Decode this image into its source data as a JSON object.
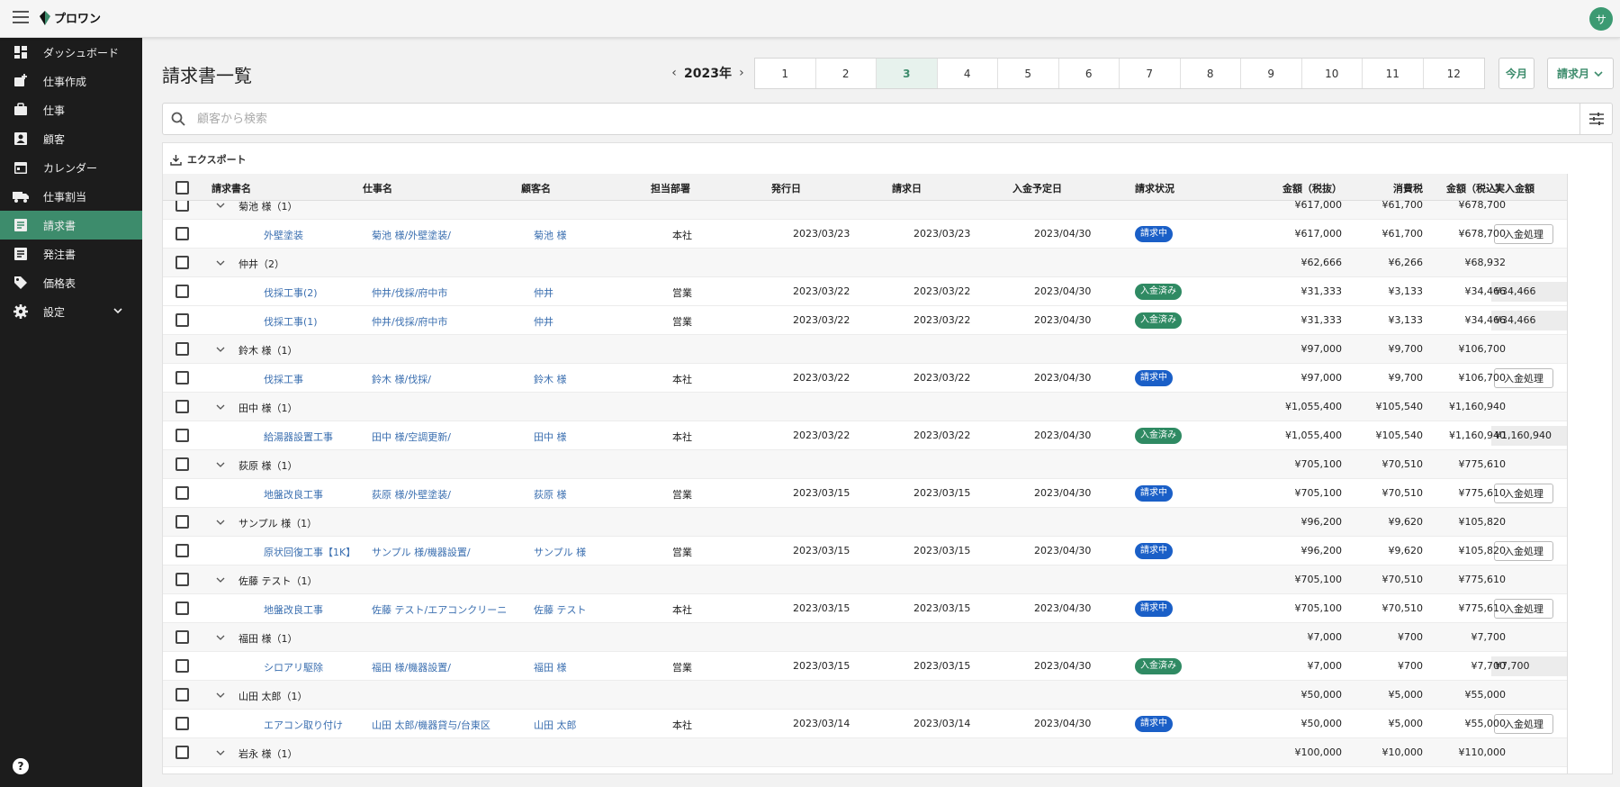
{
  "app": {
    "logo_text": "プロワン",
    "avatar_initial": "サ"
  },
  "sidebar": {
    "items": [
      {
        "label": "ダッシュボード",
        "icon": "dashboard-icon"
      },
      {
        "label": "仕事作成",
        "icon": "add-job-icon"
      },
      {
        "label": "仕事",
        "icon": "briefcase-icon"
      },
      {
        "label": "顧客",
        "icon": "customer-icon"
      },
      {
        "label": "カレンダー",
        "icon": "calendar-icon"
      },
      {
        "label": "仕事割当",
        "icon": "truck-icon"
      },
      {
        "label": "請求書",
        "icon": "invoice-icon",
        "active": true
      },
      {
        "label": "発注書",
        "icon": "order-icon"
      },
      {
        "label": "価格表",
        "icon": "price-tag-icon"
      },
      {
        "label": "設定",
        "icon": "gear-icon"
      }
    ],
    "help": "?"
  },
  "header": {
    "title": "請求書一覧",
    "year": "2023年",
    "months": [
      "1",
      "2",
      "3",
      "4",
      "5",
      "6",
      "7",
      "8",
      "9",
      "10",
      "11",
      "12"
    ],
    "selected_month": "3",
    "this_month_label": "今月",
    "sort_label": "請求月"
  },
  "search": {
    "placeholder": "顧客から検索"
  },
  "toolbar": {
    "export_label": "エクスポート"
  },
  "table": {
    "columns": [
      "請求書名",
      "仕事名",
      "顧客名",
      "担当部署",
      "発行日",
      "請求日",
      "入金予定日",
      "請求状況",
      "金額（税抜）",
      "消費税",
      "金額（税込）",
      "実入金額"
    ],
    "pay_button_label": "入金処理",
    "rows": [
      {
        "type": "group",
        "name": "菊池 様（1）",
        "ex": "¥617,000",
        "tax": "¥61,700",
        "inc": "¥678,700"
      },
      {
        "type": "item",
        "invoice": "外壁塗装",
        "job": "菊池 様/外壁塗装/",
        "customer": "菊池 様",
        "dept": "本社",
        "issued": "2023/03/23",
        "billed": "2023/03/23",
        "due": "2023/04/30",
        "status": "請求中",
        "ex": "¥617,000",
        "tax": "¥61,700",
        "inc": "¥678,700",
        "paid": ""
      },
      {
        "type": "group",
        "name": "仲井（2）",
        "ex": "¥62,666",
        "tax": "¥6,266",
        "inc": "¥68,932"
      },
      {
        "type": "item",
        "invoice": "伐採工事(2)",
        "job": "仲井/伐採/府中市",
        "customer": "仲井",
        "dept": "営業",
        "issued": "2023/03/22",
        "billed": "2023/03/22",
        "due": "2023/04/30",
        "status": "入金済み",
        "ex": "¥31,333",
        "tax": "¥3,133",
        "inc": "¥34,466",
        "paid": "¥34,466"
      },
      {
        "type": "item",
        "invoice": "伐採工事(1)",
        "job": "仲井/伐採/府中市",
        "customer": "仲井",
        "dept": "営業",
        "issued": "2023/03/22",
        "billed": "2023/03/22",
        "due": "2023/04/30",
        "status": "入金済み",
        "ex": "¥31,333",
        "tax": "¥3,133",
        "inc": "¥34,466",
        "paid": "¥34,466"
      },
      {
        "type": "group",
        "name": "鈴木 様（1）",
        "ex": "¥97,000",
        "tax": "¥9,700",
        "inc": "¥106,700"
      },
      {
        "type": "item",
        "invoice": "伐採工事",
        "job": "鈴木 様/伐採/",
        "customer": "鈴木 様",
        "dept": "本社",
        "issued": "2023/03/22",
        "billed": "2023/03/22",
        "due": "2023/04/30",
        "status": "請求中",
        "ex": "¥97,000",
        "tax": "¥9,700",
        "inc": "¥106,700",
        "paid": ""
      },
      {
        "type": "group",
        "name": "田中 様（1）",
        "ex": "¥1,055,400",
        "tax": "¥105,540",
        "inc": "¥1,160,940"
      },
      {
        "type": "item",
        "invoice": "給湯器設置工事",
        "job": "田中 様/空調更新/",
        "customer": "田中 様",
        "dept": "本社",
        "issued": "2023/03/22",
        "billed": "2023/03/22",
        "due": "2023/04/30",
        "status": "入金済み",
        "ex": "¥1,055,400",
        "tax": "¥105,540",
        "inc": "¥1,160,940",
        "paid": "¥1,160,940"
      },
      {
        "type": "group",
        "name": "荻原 様（1）",
        "ex": "¥705,100",
        "tax": "¥70,510",
        "inc": "¥775,610"
      },
      {
        "type": "item",
        "invoice": "地盤改良工事",
        "job": "荻原 様/外壁塗装/",
        "customer": "荻原 様",
        "dept": "営業",
        "issued": "2023/03/15",
        "billed": "2023/03/15",
        "due": "2023/04/30",
        "status": "請求中",
        "ex": "¥705,100",
        "tax": "¥70,510",
        "inc": "¥775,610",
        "paid": ""
      },
      {
        "type": "group",
        "name": "サンプル 様（1）",
        "ex": "¥96,200",
        "tax": "¥9,620",
        "inc": "¥105,820"
      },
      {
        "type": "item",
        "invoice": "原状回復工事【1K】",
        "job": "サンプル 様/機器設置/",
        "customer": "サンプル 様",
        "dept": "営業",
        "issued": "2023/03/15",
        "billed": "2023/03/15",
        "due": "2023/04/30",
        "status": "請求中",
        "ex": "¥96,200",
        "tax": "¥9,620",
        "inc": "¥105,820",
        "paid": ""
      },
      {
        "type": "group",
        "name": "佐藤 テスト（1）",
        "ex": "¥705,100",
        "tax": "¥70,510",
        "inc": "¥775,610"
      },
      {
        "type": "item",
        "invoice": "地盤改良工事",
        "job": "佐藤 テスト/エアコンクリーニ",
        "customer": "佐藤 テスト",
        "dept": "本社",
        "issued": "2023/03/15",
        "billed": "2023/03/15",
        "due": "2023/04/30",
        "status": "請求中",
        "ex": "¥705,100",
        "tax": "¥70,510",
        "inc": "¥775,610",
        "paid": ""
      },
      {
        "type": "group",
        "name": "福田 様（1）",
        "ex": "¥7,000",
        "tax": "¥700",
        "inc": "¥7,700"
      },
      {
        "type": "item",
        "invoice": "シロアリ駆除",
        "job": "福田 様/機器設置/",
        "customer": "福田 様",
        "dept": "営業",
        "issued": "2023/03/15",
        "billed": "2023/03/15",
        "due": "2023/04/30",
        "status": "入金済み",
        "ex": "¥7,000",
        "tax": "¥700",
        "inc": "¥7,700",
        "paid": "¥7,700"
      },
      {
        "type": "group",
        "name": "山田 太郎（1）",
        "ex": "¥50,000",
        "tax": "¥5,000",
        "inc": "¥55,000"
      },
      {
        "type": "item",
        "invoice": "エアコン取り付け",
        "job": "山田 太郎/機器貸与/台東区",
        "customer": "山田 太郎",
        "dept": "本社",
        "issued": "2023/03/14",
        "billed": "2023/03/14",
        "due": "2023/04/30",
        "status": "請求中",
        "ex": "¥50,000",
        "tax": "¥5,000",
        "inc": "¥55,000",
        "paid": ""
      },
      {
        "type": "group",
        "name": "岩永 様（1）",
        "ex": "¥100,000",
        "tax": "¥10,000",
        "inc": "¥110,000"
      }
    ]
  },
  "colors": {
    "accent": "#3d8c6c",
    "status_invoiced": "#1a5fc7",
    "status_paid": "#2f8a63",
    "sidebar_bg": "#1c1c1c"
  }
}
